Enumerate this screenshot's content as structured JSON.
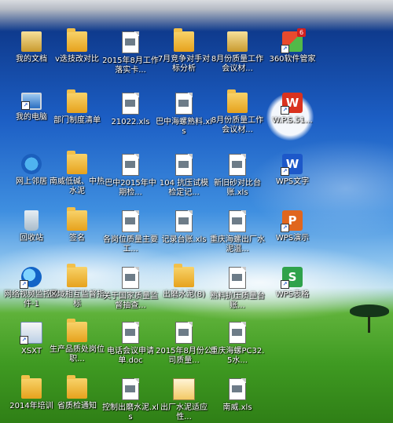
{
  "desktop": {
    "icons": [
      {
        "label": "我的文档",
        "type": "docs"
      },
      {
        "label": "v迭技改对比",
        "type": "folder"
      },
      {
        "label": "2015年8月工作落实卡...",
        "type": "doc"
      },
      {
        "label": "7月竞争对手对标分析",
        "type": "folder"
      },
      {
        "label": "8月份质量工作会议材...",
        "type": "docs"
      },
      {
        "label": "360软件管家",
        "type": "app-360",
        "badge": "6"
      },
      {
        "label": "我的电脑",
        "type": "computer"
      },
      {
        "label": "部门制度清单",
        "type": "folder"
      },
      {
        "label": "21022.xls",
        "type": "doc"
      },
      {
        "label": "巴中海螺熟料.xls",
        "type": "doc"
      },
      {
        "label": "8月份质量工作会议材...",
        "type": "folder"
      },
      {
        "label": "W.P.S.51...",
        "type": "app-red",
        "glyph": "W"
      },
      {
        "label": "网上邻居",
        "type": "network"
      },
      {
        "label": "南威低碱、中热水泥",
        "type": "folder"
      },
      {
        "label": "巴中2015年中期检...",
        "type": "doc"
      },
      {
        "label": "104 抗压试模检定记...",
        "type": "doc"
      },
      {
        "label": "新旧砂对比台账.xls",
        "type": "doc"
      },
      {
        "label": "WPS文字",
        "type": "app-blue",
        "glyph": "W"
      },
      {
        "label": "回收站",
        "type": "recycle"
      },
      {
        "label": "签名",
        "type": "folder"
      },
      {
        "label": "各岗位质量主要工...",
        "type": "doc"
      },
      {
        "label": "记录台账.xls",
        "type": "doc"
      },
      {
        "label": "重庆海螺出厂水泥温...",
        "type": "doc"
      },
      {
        "label": "WPS演示",
        "type": "app-orange",
        "glyph": "P"
      },
      {
        "label": "网络视频监控软件-1",
        "type": "globe"
      },
      {
        "label": "区域相互监督指标",
        "type": "folder"
      },
      {
        "label": "关于国家质量监督抽查...",
        "type": "doc"
      },
      {
        "label": "出磨水泥(8)",
        "type": "folder"
      },
      {
        "label": "熟料抗压质量台账...",
        "type": "doc"
      },
      {
        "label": "WPS表格",
        "type": "app-green",
        "glyph": "S"
      },
      {
        "label": "XSXT",
        "type": "xsxt"
      },
      {
        "label": "生产品质处岗位职...",
        "type": "folder"
      },
      {
        "label": "电话会议申请单.doc",
        "type": "doc"
      },
      {
        "label": "2015年8月份公司质量...",
        "type": "doc"
      },
      {
        "label": "重庆海螺PC32.5水...",
        "type": "doc"
      },
      {
        "label": "",
        "type": "none"
      },
      {
        "label": "2014年培训",
        "type": "folder"
      },
      {
        "label": "省质检通知",
        "type": "folder"
      },
      {
        "label": "控制出磨水泥.xls",
        "type": "doc"
      },
      {
        "label": "出厂水泥适应性...",
        "type": "exe"
      },
      {
        "label": "南威.xls",
        "type": "doc"
      },
      {
        "label": "",
        "type": "none"
      }
    ]
  }
}
